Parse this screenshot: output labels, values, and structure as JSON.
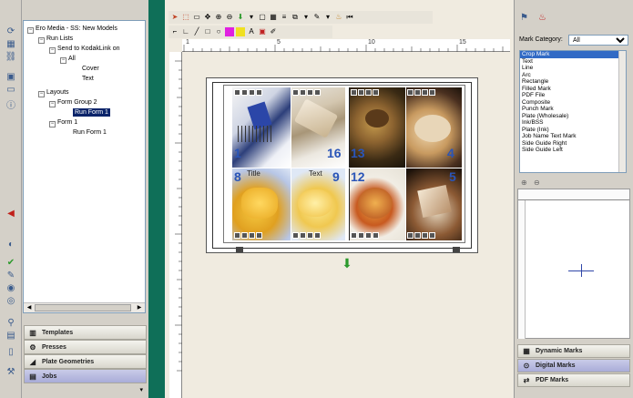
{
  "tree": {
    "root": "Ero Media - SS: New Models",
    "run_lists": "Run Lists",
    "send_to": "Send to KodakLink on",
    "all": "All",
    "cover": "Cover",
    "text": "Text",
    "layouts": "Layouts",
    "form_group_2": "Form Group 2",
    "run_form_1_sel": "Run Form 1",
    "form_1": "Form 1",
    "run_form_1": "Run Form 1"
  },
  "left_accordion": [
    {
      "label": "Templates",
      "icon": "templates-icon",
      "glyph": "▥"
    },
    {
      "label": "Presses",
      "icon": "presses-icon",
      "glyph": "⚙"
    },
    {
      "label": "Plate Geometries",
      "icon": "plate-geometries-icon",
      "glyph": "◢"
    },
    {
      "label": "Jobs",
      "icon": "jobs-icon",
      "glyph": "▤"
    }
  ],
  "right_panel": {
    "category_label": "Mark Category:",
    "category_value": "All",
    "marks": [
      "Crop Mark",
      "Text",
      "Line",
      "Arc",
      "Rectangle",
      "Filled Mark",
      "PDF File",
      "Composite",
      "Punch Mark",
      "Plate (Wholesale)",
      "Ink/BSS",
      "Plate (Ink)",
      "Job Name Text Mark",
      "Side Guide Right",
      "Side Guide Left"
    ],
    "accordion": [
      {
        "label": "Dynamic Marks",
        "icon": "dynamic-marks-icon",
        "glyph": "▦"
      },
      {
        "label": "Digital Marks",
        "icon": "digital-marks-icon",
        "glyph": "⊙"
      },
      {
        "label": "PDF Marks",
        "icon": "pdf-marks-icon",
        "glyph": "⇄"
      }
    ]
  },
  "ruler": {
    "top": [
      "1",
      "5",
      "10",
      "15"
    ]
  },
  "sheet": {
    "page_numbers": [
      "1",
      "16",
      "13",
      "4",
      "8",
      "9",
      "12",
      "5"
    ],
    "title_labels": [
      "Title",
      "Text"
    ]
  },
  "colors": {
    "green_divider": "#0f6f58",
    "selection": "#316ac5",
    "page_number": "#2a55b8"
  }
}
